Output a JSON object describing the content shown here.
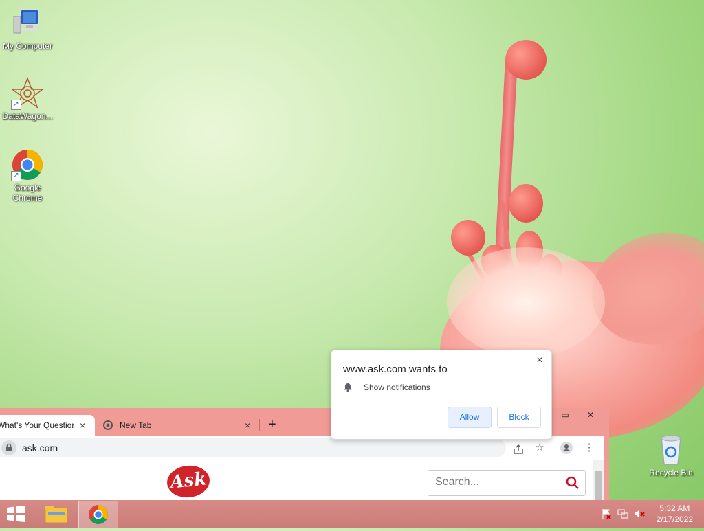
{
  "desktop": {
    "icons": [
      {
        "label": "My Computer"
      },
      {
        "label": "DataWagon..."
      },
      {
        "label": "Google Chrome"
      }
    ],
    "recycle_bin": {
      "label": "Recycle Bin"
    }
  },
  "chrome": {
    "tabs": [
      {
        "label": "What's Your Question?",
        "close": "×"
      },
      {
        "label": "New Tab",
        "close": "×"
      }
    ],
    "new_tab": "+",
    "window_buttons": {
      "restore": "▭",
      "close": "✕"
    },
    "address": {
      "url": "ask.com"
    },
    "page": {
      "logo_text": "Ask",
      "search_placeholder": "Search..."
    }
  },
  "popup": {
    "title": "www.ask.com wants to",
    "permission": "Show notifications",
    "allow": "Allow",
    "block": "Block",
    "close": "×"
  },
  "taskbar": {
    "time": "5:32 AM",
    "date": "2/17/2022"
  },
  "colors": {
    "chrome_frame": "#f19b96",
    "taskbar": "#d88b86",
    "accent_blue": "#1a73e8",
    "ask_red": "#d1242a"
  }
}
